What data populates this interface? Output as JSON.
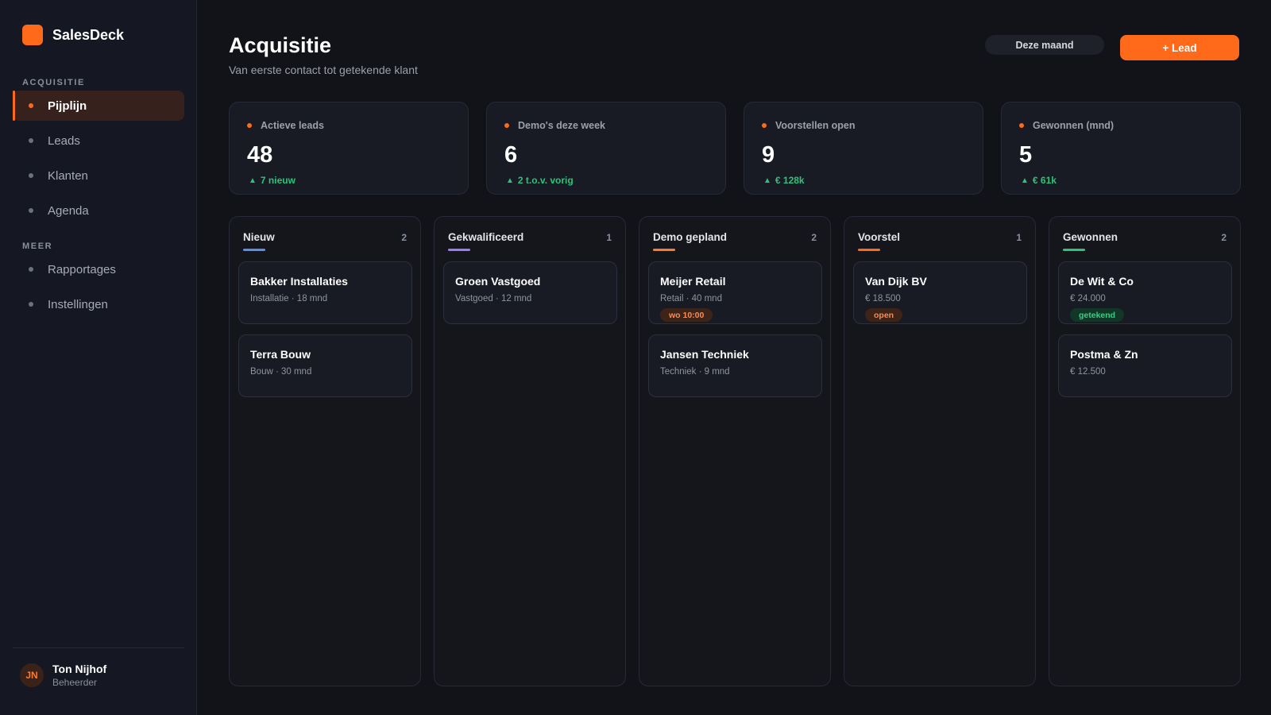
{
  "app": {
    "name": "SalesDeck"
  },
  "colors": {
    "accent": "#ff6a1a",
    "positive": "#2fc27a"
  },
  "sidebar": {
    "sections": [
      {
        "label": "ACQUISITIE",
        "items": [
          {
            "label": "Pijplijn",
            "active": true
          },
          {
            "label": "Leads"
          },
          {
            "label": "Klanten"
          },
          {
            "label": "Agenda"
          }
        ]
      },
      {
        "label": "MEER",
        "items": [
          {
            "label": "Rapportages"
          },
          {
            "label": "Instellingen"
          }
        ]
      }
    ],
    "user": {
      "initials": "JN",
      "name": "Ton Nijhof",
      "role": "Beheerder"
    }
  },
  "header": {
    "title": "Acquisitie",
    "subtitle": "Van eerste contact tot getekende klant",
    "period": "Deze maand",
    "add_button": "+ Lead"
  },
  "stats": [
    {
      "label": "Actieve leads",
      "value": "48",
      "delta": "7 nieuw",
      "delta_icon": "▲"
    },
    {
      "label": "Demo's deze week",
      "value": "6",
      "delta": "2 t.o.v. vorig",
      "delta_icon": "▲"
    },
    {
      "label": "Voorstellen open",
      "value": "9",
      "delta": "€ 128k",
      "delta_icon": "▲"
    },
    {
      "label": "Gewonnen (mnd)",
      "value": "5",
      "delta": "€ 61k",
      "delta_icon": "▲"
    }
  ],
  "columns": [
    {
      "title": "Nieuw",
      "count": "2",
      "color": "#5b8def",
      "cards": [
        {
          "title": "Bakker Installaties",
          "meta": "Installatie · 18 mnd"
        },
        {
          "title": "Terra Bouw",
          "meta": "Bouw · 30 mnd"
        }
      ]
    },
    {
      "title": "Gekwalificeerd",
      "count": "1",
      "color": "#9b7cf2",
      "cards": [
        {
          "title": "Groen Vastgoed",
          "meta": "Vastgoed · 12 mnd"
        }
      ]
    },
    {
      "title": "Demo gepland",
      "count": "2",
      "color": "#ff7a2e",
      "cards": [
        {
          "title": "Meijer Retail",
          "meta": "Retail · 40 mnd",
          "badge": "wo 10:00",
          "badge_style": "orange"
        },
        {
          "title": "Jansen Techniek",
          "meta": "Techniek · 9 mnd"
        }
      ]
    },
    {
      "title": "Voorstel",
      "count": "1",
      "color": "#ff6a1a",
      "cards": [
        {
          "title": "Van Dijk BV",
          "meta": "€ 18.500",
          "badge": "open",
          "badge_style": "orange"
        }
      ]
    },
    {
      "title": "Gewonnen",
      "count": "2",
      "color": "#2fc27a",
      "cards": [
        {
          "title": "De Wit & Co",
          "meta": "€ 24.000",
          "badge": "getekend",
          "badge_style": "green"
        },
        {
          "title": "Postma & Zn",
          "meta": "€ 12.500"
        }
      ]
    }
  ]
}
